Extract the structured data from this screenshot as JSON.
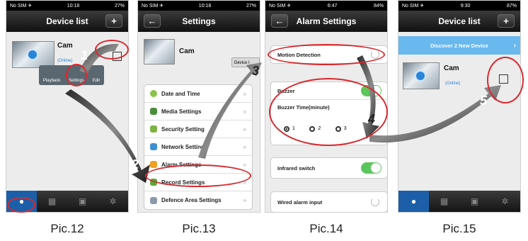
{
  "phones": [
    {
      "status": {
        "carrier": "No SIM ✈",
        "time": "10:18",
        "battery": "27%"
      },
      "nav_title": "Device list",
      "nav_right": "+",
      "device": {
        "name": "Cam",
        "status": "(Online)"
      },
      "popup": [
        "Playback",
        "Settings",
        "Edit"
      ],
      "caption": "Pic.12"
    },
    {
      "status": {
        "carrier": "No SIM ✈",
        "time": "10:18",
        "battery": "27%"
      },
      "nav_title": "Settings",
      "nav_left": "←",
      "device": {
        "name": "Cam",
        "button": "Device I"
      },
      "rows": [
        "Date and Time",
        "Media Settings",
        "Security Setting",
        "Network Settings",
        "Alarm Settings",
        "Record Settings",
        "Defence Area Settings"
      ],
      "caption": "Pic.13"
    },
    {
      "status": {
        "carrier": "No SIM ✈",
        "time": "6:47",
        "battery": "84%"
      },
      "nav_title": "Alarm Settings",
      "nav_left": "←",
      "motion": "Motion Detection",
      "buzzer": "Buzzer",
      "buzzer_time": "Buzzer Time(minute)",
      "radio_options": [
        "1",
        "2",
        "3"
      ],
      "infrared": "Infrared switch",
      "wired": "Wired alarm input",
      "caption": "Pic.14"
    },
    {
      "status": {
        "carrier": "No SIM ✈",
        "time": "9:30",
        "battery": "87%"
      },
      "nav_title": "Device list",
      "nav_right": "+",
      "discover": "Discover 2 New Device",
      "device": {
        "name": "Cam",
        "status": "(Online)"
      },
      "caption": "Pic.15"
    }
  ],
  "steps": [
    "1",
    "2",
    "3",
    "4",
    "5"
  ],
  "tab_icons": [
    "person-icon",
    "grid-icon",
    "toolbox-icon",
    "gear-icon"
  ],
  "colors": {
    "accent": "#1c5fa8",
    "annotation": "#d72a2f",
    "switch": "#5cc55c",
    "discover": "#69b8ee"
  }
}
